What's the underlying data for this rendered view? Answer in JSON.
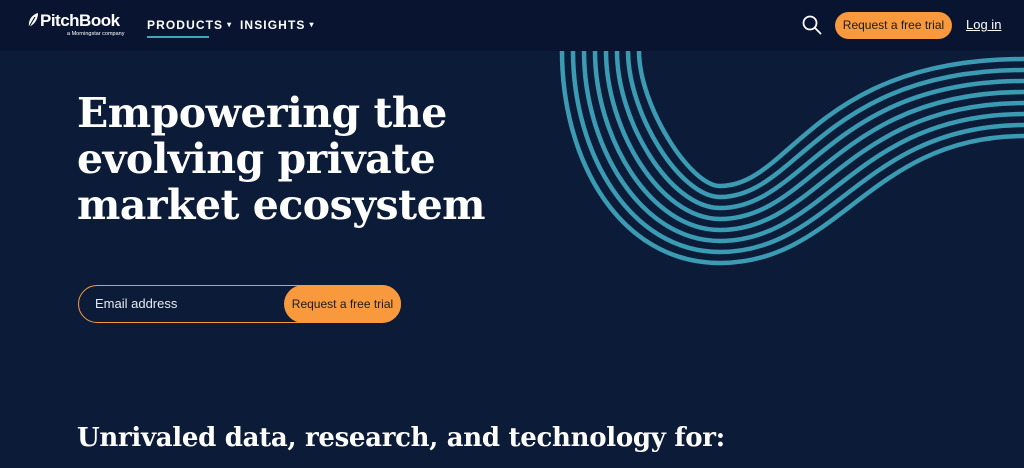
{
  "header": {
    "logo": {
      "name": "PitchBook",
      "subtitle": "a Morningstar company",
      "icon": "leaf-icon"
    },
    "nav": [
      {
        "label": "PRODUCTS",
        "caret": "▾",
        "active": true
      },
      {
        "label": "INSIGHTS",
        "caret": "▾",
        "active": false
      }
    ],
    "search_icon": "search-icon",
    "cta_label": "Request a free trial",
    "login_label": "Log in"
  },
  "hero": {
    "title_lines": [
      "Empowering the",
      "evolving private",
      "market ecosystem"
    ],
    "email": {
      "placeholder": "Email address",
      "value": ""
    },
    "submit_label": "Request a free trial",
    "decoration": "wave-lines-graphic"
  },
  "tagline": "Unrivaled data, research, and technology for:",
  "colors": {
    "background": "#0c1c38",
    "header_bg": "#091530",
    "accent": "#f7993c",
    "wave": "#3a9bb3",
    "nav_underline": "#3fa7b8"
  }
}
